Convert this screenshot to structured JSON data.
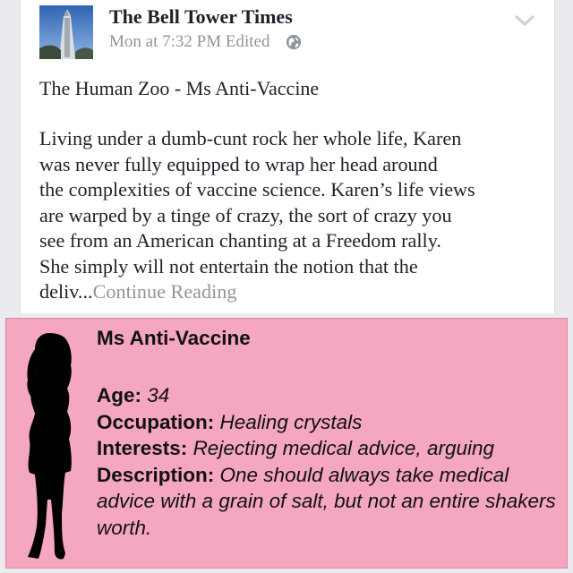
{
  "post": {
    "page_name": "The Bell Tower Times",
    "timestamp": "Mon at 7:32 PM",
    "edited_label": "Edited",
    "privacy_icon": "globe-icon",
    "menu_icon": "chevron-down-icon",
    "headline": "The Human Zoo - Ms Anti-Vaccine",
    "body_lines": [
      "Living under a dumb-cunt rock her whole life, Karen",
      "was never fully equipped to wrap her head around",
      "the complexities of vaccine science. Karen’s life views",
      "are warped by a tinge of crazy, the sort of crazy you",
      "see from an American chanting at a Freedom rally.",
      "She simply will not entertain the notion that the"
    ],
    "truncated_tail": "deliv...",
    "continue_label": "Continue Reading"
  },
  "profile_card": {
    "background_color": "#f4a7be",
    "title": "Ms Anti-Vaccine",
    "age_label": "Age:",
    "age_value": "34",
    "occupation_label": "Occupation:",
    "occupation_value": "Healing crystals",
    "interests_label": "Interests:",
    "interests_value": "Rejecting medical advice, arguing",
    "description_label": "Description:",
    "description_value": "One should always take medical advice with a grain of salt, but not an entire shakers worth."
  }
}
